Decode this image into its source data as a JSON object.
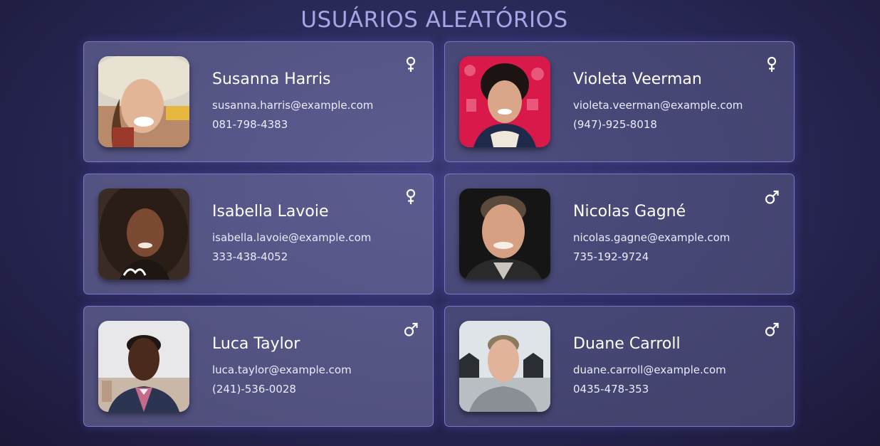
{
  "page": {
    "title": "USUÁRIOS ALEATÓRIOS"
  },
  "colors": {
    "title": "#a9a4e6",
    "card_border": "#7a78c0",
    "background": "#2a2a5a"
  },
  "users": [
    {
      "name": "Susanna Harris",
      "email": "susanna.harris@example.com",
      "phone": "081-798-4383",
      "gender_icon": "female-icon"
    },
    {
      "name": "Violeta Veerman",
      "email": "violeta.veerman@example.com",
      "phone": "(947)-925-8018",
      "gender_icon": "female-icon"
    },
    {
      "name": "Isabella Lavoie",
      "email": "isabella.lavoie@example.com",
      "phone": "333-438-4052",
      "gender_icon": "female-icon"
    },
    {
      "name": "Nicolas Gagné",
      "email": "nicolas.gagne@example.com",
      "phone": "735-192-9724",
      "gender_icon": "male-icon"
    },
    {
      "name": "Luca Taylor",
      "email": "luca.taylor@example.com",
      "phone": "(241)-536-0028",
      "gender_icon": "male-icon"
    },
    {
      "name": "Duane Carroll",
      "email": "duane.carroll@example.com",
      "phone": "0435-478-353",
      "gender_icon": "male-icon"
    }
  ]
}
